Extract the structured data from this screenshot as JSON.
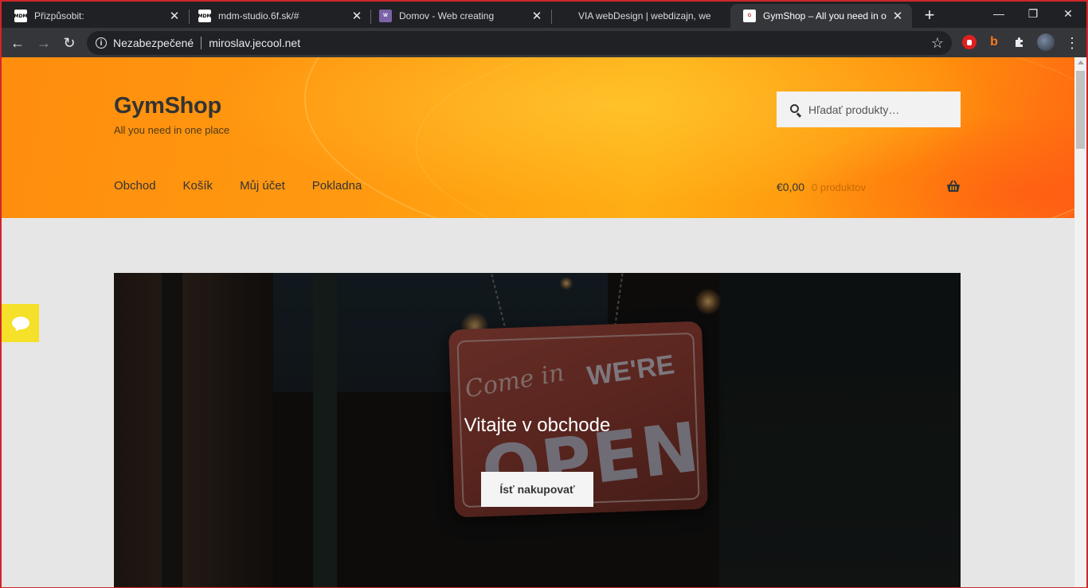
{
  "browser": {
    "tabs": [
      {
        "favicon": "mdm-icon",
        "title": "Přizpůsobit:"
      },
      {
        "favicon": "mdm-icon",
        "title": "mdm-studio.6f.sk/#"
      },
      {
        "favicon": "wordpress-icon",
        "title": "Domov - Web creating"
      },
      {
        "favicon": "blank-icon",
        "title": "VIA webDesign | webdizajn, we"
      },
      {
        "favicon": "gymshop-icon",
        "title": "GymShop – All you need in one"
      }
    ],
    "favicon_text": {
      "mdm": "MDM",
      "wordpress": "W",
      "gymshop": "G"
    },
    "close_glyph": "✕",
    "new_tab_glyph": "+",
    "window_controls": {
      "minimize": "—",
      "maximize": "❐",
      "close": "✕"
    },
    "toolbar": {
      "back_glyph": "←",
      "forward_glyph": "→",
      "reload_glyph": "↻",
      "info_glyph": "i",
      "security_label": "Nezabezpečené",
      "url": "miroslav.jecool.net",
      "star_glyph": "☆",
      "menu_glyph": "⋮"
    },
    "extensions": [
      "adblock-icon",
      "b-extension-icon",
      "puzzle-icon",
      "profile-avatar"
    ]
  },
  "site": {
    "title": "GymShop",
    "tagline": "All you need in one place",
    "search_placeholder": "Hľadať produkty…",
    "nav": [
      "Obchod",
      "Košík",
      "Můj účet",
      "Pokladna"
    ],
    "cart": {
      "amount": "€0,00",
      "count": "0 produktov"
    },
    "hero": {
      "title": "Vitajte v obchode",
      "button": "Ísť nakupovať",
      "sign_come": "Come in",
      "sign_were": "WE'RE",
      "sign_open": "OPEN"
    }
  },
  "colors": {
    "frame_border": "#d0262a",
    "tab_strip": "#202124",
    "toolbar": "#35363a",
    "header_orange": "#ff9a10",
    "chat_yellow": "#f5e02a",
    "page_background": "#e6e6e6"
  }
}
